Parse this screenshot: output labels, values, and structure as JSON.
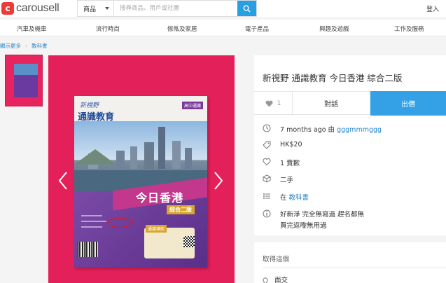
{
  "header": {
    "logo_mark": "c",
    "logo_text": "carousell",
    "search_category": "商品",
    "search_placeholder": "搜尋商品、用戶或社團",
    "login": "登入"
  },
  "categories": [
    "汽車及機車",
    "流行時尚",
    "傢俬及家居",
    "電子產品",
    "興趣及遊戲",
    "工作及服務"
  ],
  "breadcrumb": {
    "back": "顯示更多",
    "current": "教科書"
  },
  "listing": {
    "title": "新視野 通識教育 今日香港 綜合二版",
    "likes": "1",
    "chat_label": "對話",
    "offer_label": "出價",
    "time_ago": "7 months ago 由",
    "seller": "gggmmmggg",
    "price": "HK$20",
    "quantity": "1 賣歉",
    "condition": "二手",
    "category_prefix": "在",
    "category": "教科書",
    "description_line1": "好新淨 完全無寫過 趕名都無",
    "description_line2": "買完返嚟無用過"
  },
  "pickup": {
    "title": "取得這個",
    "method": "面交"
  },
  "book_cover": {
    "tag": "高中通識",
    "series": "新視野",
    "title": "通識教育",
    "hk": "今日香港",
    "sub": "綜合二版",
    "gold_head": "通識導航"
  },
  "colors": {
    "accent": "#34a0e6",
    "brand": "#ef3a3a",
    "photo_bg": "#e4205a"
  }
}
